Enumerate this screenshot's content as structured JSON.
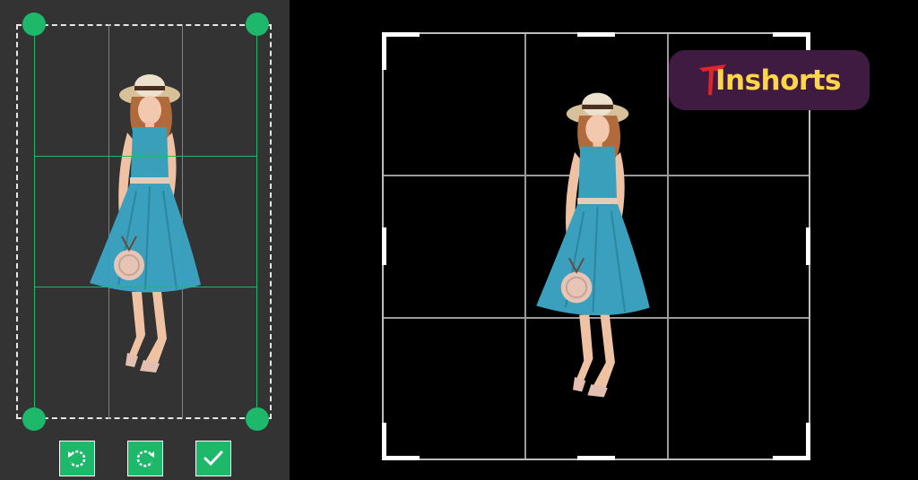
{
  "logo": {
    "text": "Inshorts",
    "text_color": "#ffd54a",
    "accent_color": "#e0242c",
    "background": "#3f1b42"
  },
  "left_panel": {
    "background": "#333333",
    "accent_color": "#1db86a",
    "image_subject": "woman-in-blue-dress"
  },
  "actions": [
    {
      "name": "rotate-left",
      "icon": "rotate-counterclockwise-icon"
    },
    {
      "name": "rotate-right",
      "icon": "rotate-clockwise-icon"
    },
    {
      "name": "confirm",
      "icon": "checkmark-icon"
    }
  ],
  "editor": {
    "background": "#000000",
    "grid": "3x3",
    "image_subject": "woman-in-blue-dress"
  }
}
